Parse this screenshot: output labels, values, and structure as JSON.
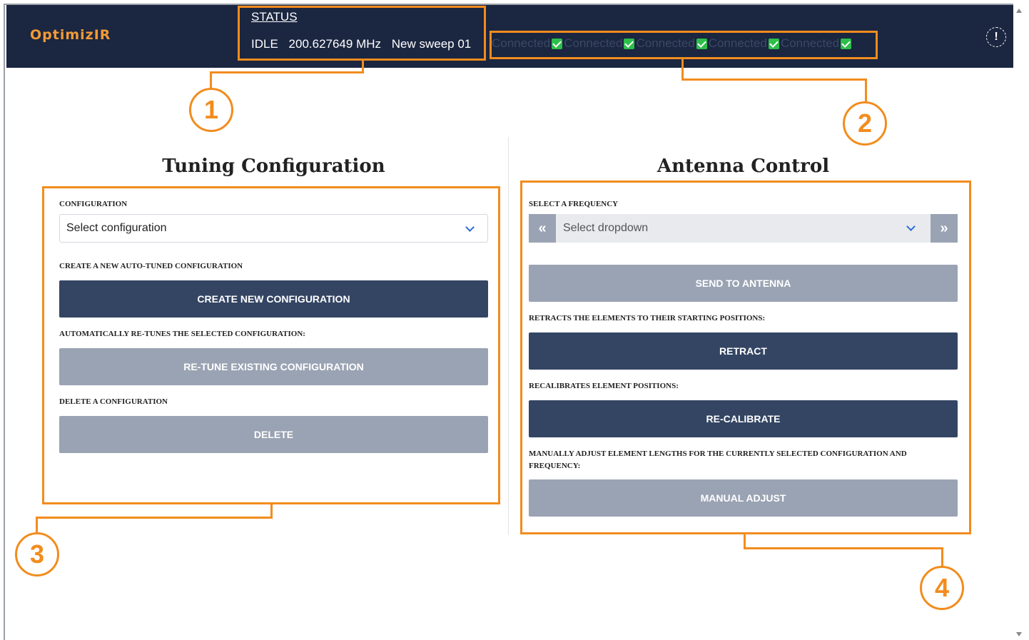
{
  "app": {
    "logo": "OptimizIR",
    "alert_icon": "alert-icon",
    "status": {
      "link": "STATUS",
      "state": "IDLE",
      "frequency": "200.627649 MHz",
      "sweep": "New sweep 01"
    },
    "connections": [
      {
        "label": "Connected"
      },
      {
        "label": "Connected"
      },
      {
        "label": "Connected"
      },
      {
        "label": "Connected"
      },
      {
        "label": "Connected"
      }
    ]
  },
  "tuning": {
    "title": "Tuning Configuration",
    "config_label": "CONFIGURATION",
    "config_select": "Select configuration",
    "create_label": "CREATE A NEW AUTO-TUNED CONFIGURATION",
    "create_button": "CREATE NEW CONFIGURATION",
    "retune_label": "AUTOMATICALLY RE-TUNES THE SELECTED CONFIGURATION:",
    "retune_button": "RE-TUNE EXISTING CONFIGURATION",
    "delete_label": "DELETE A CONFIGURATION",
    "delete_button": "DELETE"
  },
  "antenna": {
    "title": "Antenna Control",
    "freq_label": "SELECT A FREQUENCY",
    "freq_select": "Select dropdown",
    "prev": "«",
    "next": "»",
    "send_button": "SEND TO ANTENNA",
    "retract_label": "RETRACTS THE ELEMENTS TO THEIR STARTING POSITIONS:",
    "retract_button": "RETRACT",
    "recal_label": "RECALIBRATES ELEMENT POSITIONS:",
    "recal_button": "RE-CALIBRATE",
    "manual_label": "MANUALLY ADJUST ELEMENT LENGTHS FOR THE CURRENTLY SELECTED CONFIGURATION AND FREQUENCY:",
    "manual_button": "MANUAL ADJUST"
  },
  "annotations": {
    "callouts": [
      "1",
      "2",
      "3",
      "4"
    ],
    "color": "#f28c1e"
  },
  "colors": {
    "header_bg": "#1b2640",
    "logo": "#f29a36",
    "button_dark": "#344563",
    "button_disabled": "#9aa3b3",
    "connected_check": "#2dbf4a"
  }
}
